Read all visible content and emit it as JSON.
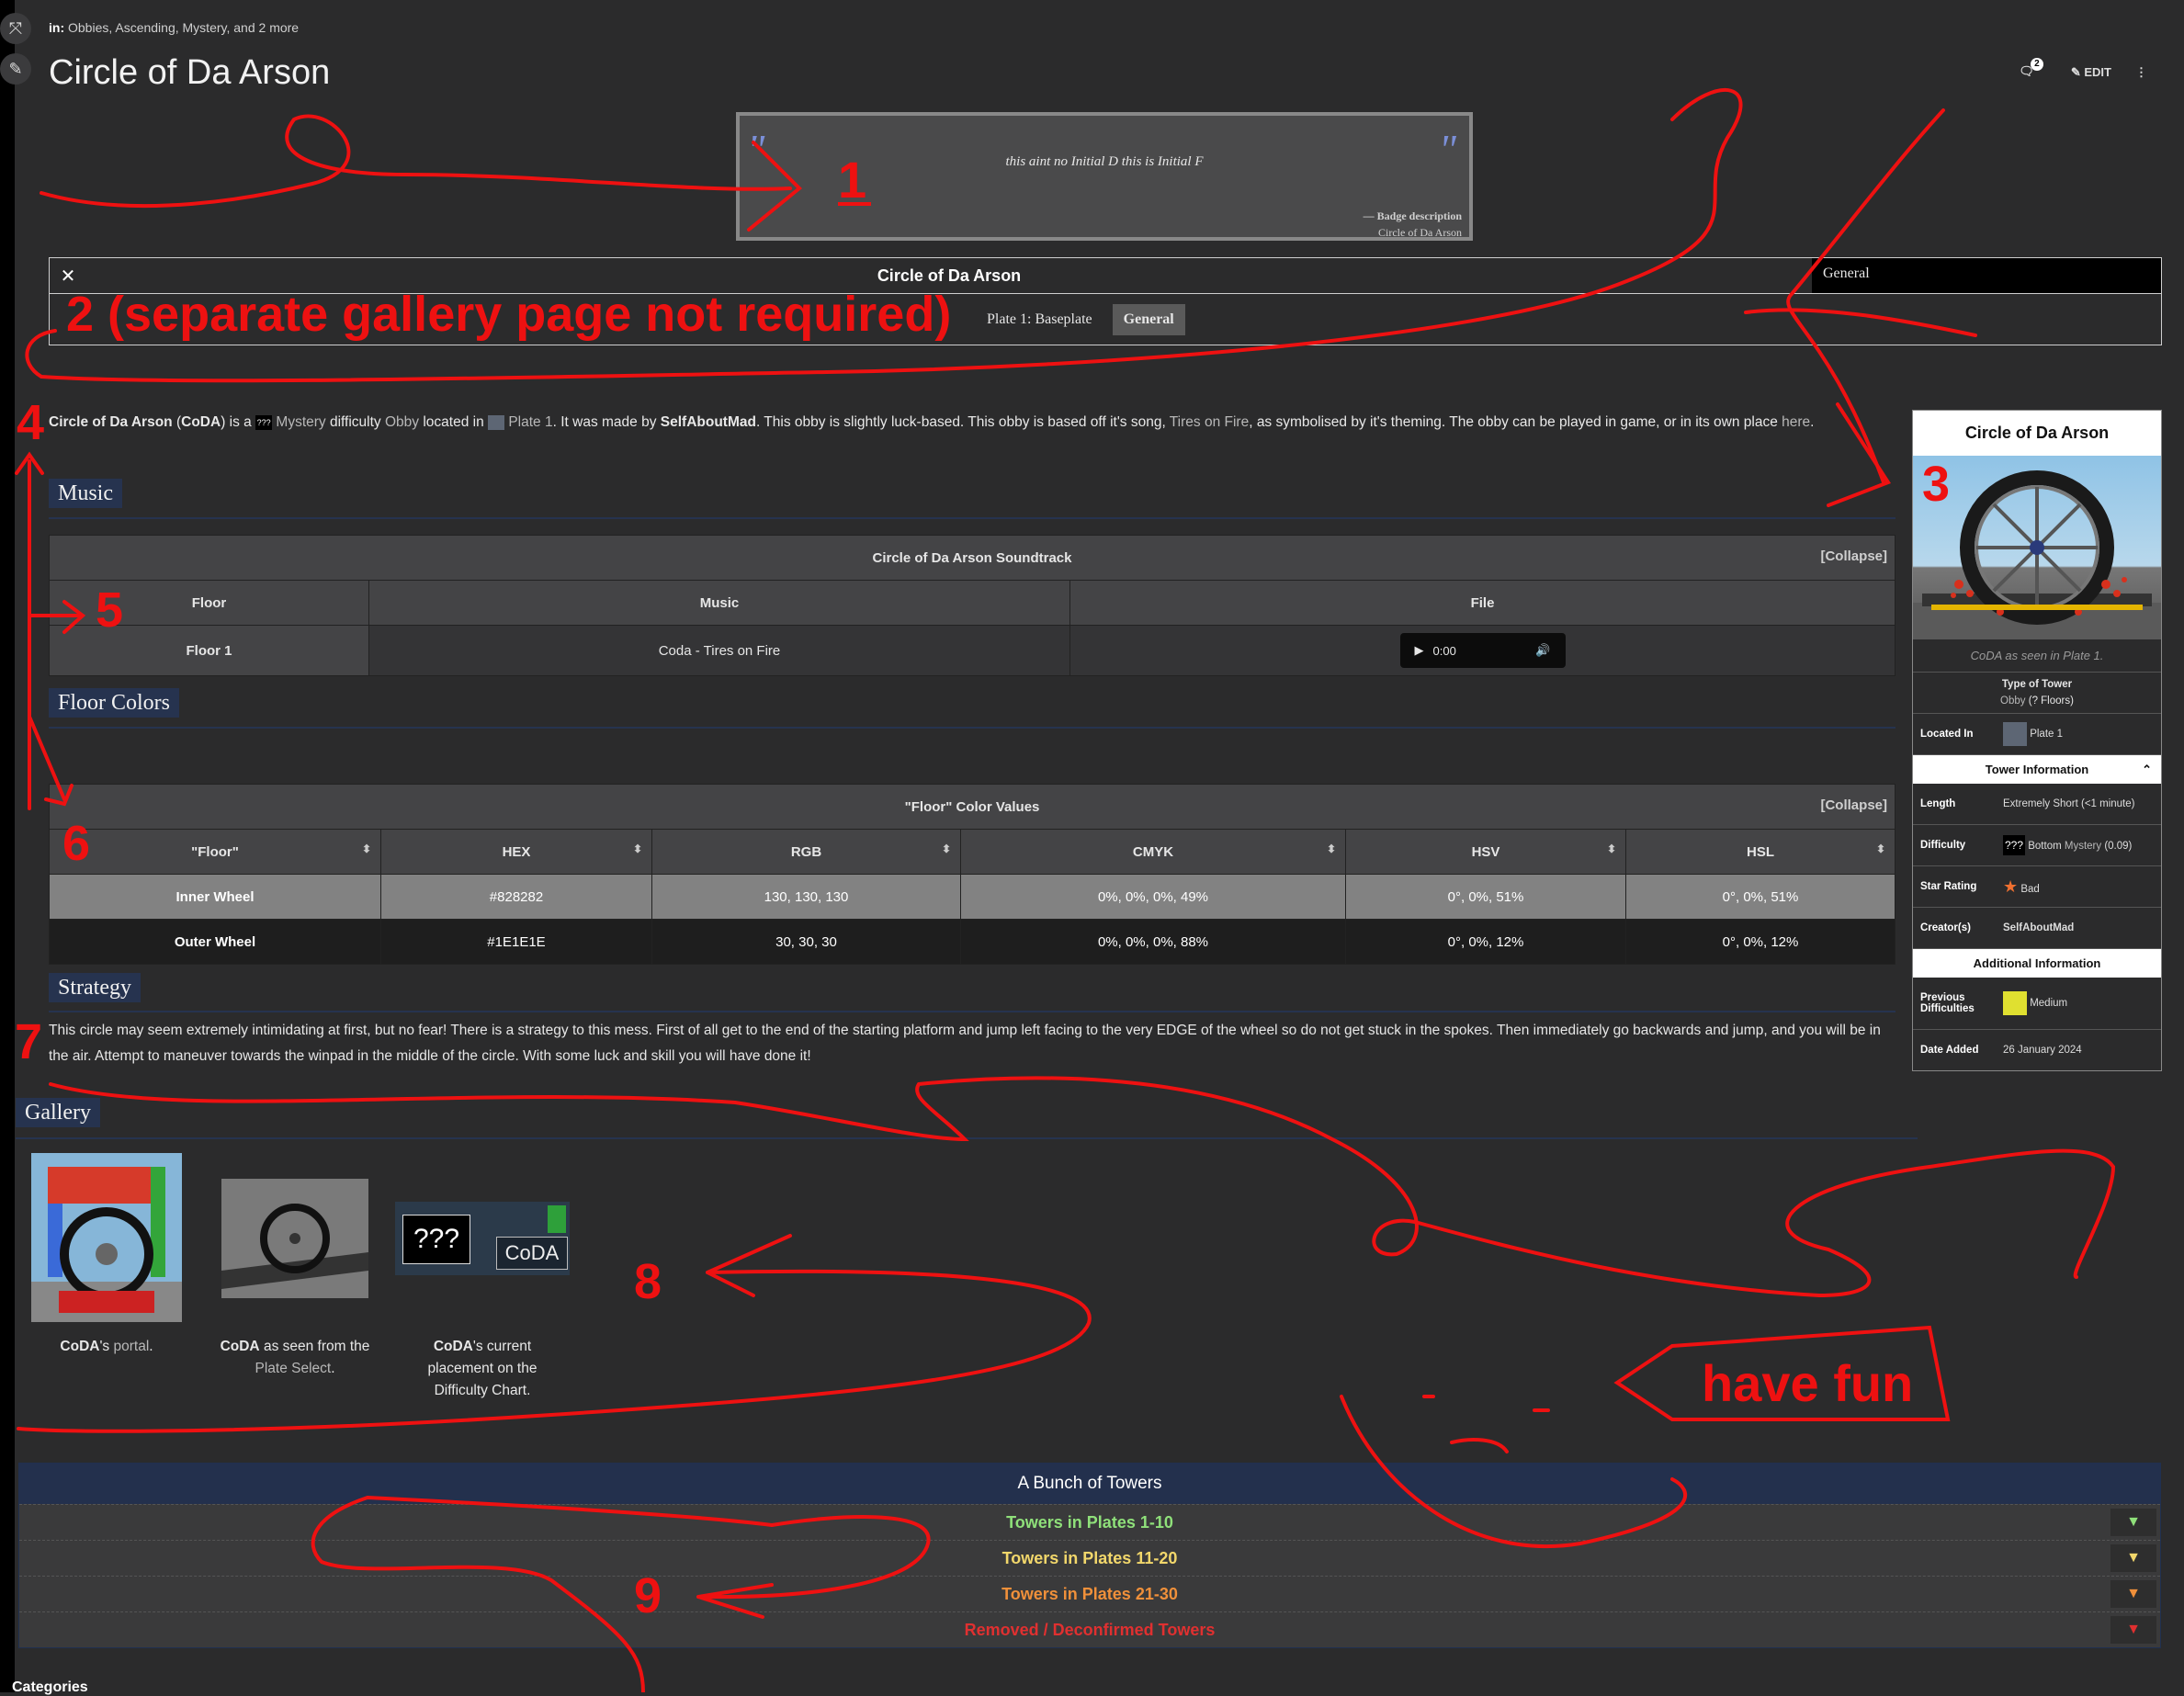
{
  "page": {
    "categories_prefix": "in:",
    "categories": "Obbies, Ascending, Mystery, and 2 more",
    "title": "Circle of Da Arson",
    "comment_count": "2",
    "edit_label": "EDIT"
  },
  "quote": {
    "text": "this aint no Initial D this is Initial F",
    "cite_label": "— Badge description",
    "cite_source": "Circle of Da Arson"
  },
  "tabber": {
    "title": "Circle of Da Arson",
    "right_tab": "General",
    "tab_plate": "Plate 1: Baseplate",
    "tab_general": "General"
  },
  "intro": {
    "name_bold": "Circle of Da Arson",
    "abbr": "CoDA",
    "t1": " is a ",
    "icon_text": "???",
    "difficulty": "Mystery",
    "t2": " difficulty ",
    "obby": "Obby",
    "t3": " located in ",
    "plate": "Plate 1",
    "t4": ". It was made by ",
    "creator": "SelfAboutMad",
    "t5": ". This obby is slightly luck-based. This obby is based off it's song, ",
    "song": "Tires on Fire",
    "t6": ", as symbolised by it's theming. The obby can be played in game, or in its own place ",
    "here": "here",
    "t7": "."
  },
  "music": {
    "heading": "Music",
    "table_title": "Circle of Da Arson Soundtrack",
    "collapse": "[Collapse]",
    "headers": [
      "Floor",
      "Music",
      "File"
    ],
    "row": {
      "floor": "Floor 1",
      "music": "Coda - Tires on Fire",
      "time": "0:00"
    }
  },
  "colors": {
    "heading": "Floor Colors",
    "table_title": "\"Floor\" Color Values",
    "collapse": "[Collapse]",
    "headers": [
      "\"Floor\"",
      "HEX",
      "RGB",
      "CMYK",
      "HSV",
      "HSL"
    ],
    "rows": [
      {
        "name": "Inner Wheel",
        "hex": "#828282",
        "rgb": "130, 130, 130",
        "cmyk": "0%, 0%, 0%, 49%",
        "hsv": "0°, 0%, 51%",
        "hsl": "0°, 0%, 51%"
      },
      {
        "name": "Outer Wheel",
        "hex": "#1E1E1E",
        "rgb": "30, 30, 30",
        "cmyk": "0%, 0%, 0%, 88%",
        "hsv": "0°, 0%, 12%",
        "hsl": "0°, 0%, 12%"
      }
    ]
  },
  "strategy": {
    "heading": "Strategy",
    "text": "This circle may seem extremely intimidating at first, but no fear! There is a strategy to this mess. First of all get to the end of the starting platform and jump left facing to the very EDGE of the wheel so do not get stuck in the spokes. Then immediately go backwards and jump, and you will be in the air. Attempt to maneuver towards the winpad in the middle of the circle. With some luck and skill you will have done it!"
  },
  "infobox": {
    "title": "Circle of Da Arson",
    "caption": "CoDA as seen in Plate 1.",
    "type_label": "Type of Tower",
    "type_value_link": "Obby",
    "type_value_rest": " (? Floors)",
    "located_label": "Located In",
    "located_value": "Plate 1",
    "tower_info": "Tower Information",
    "length_label": "Length",
    "length_value": "Extremely Short (<1 minute)",
    "difficulty_label": "Difficulty",
    "difficulty_icon": "???",
    "difficulty_value": "Bottom",
    "difficulty_link": "Mystery",
    "difficulty_num": "(0.09)",
    "star_label": "Star Rating",
    "star_value": "Bad",
    "creator_label": "Creator(s)",
    "creator_value": "SelfAboutMad",
    "additional": "Additional Information",
    "prev_label": "Previous Difficulties",
    "prev_value": "Medium",
    "date_label": "Date Added",
    "date_value": "26 January 2024"
  },
  "gallery": {
    "heading": "Gallery",
    "items": [
      {
        "bold": "CoDA",
        "rest": "'s ",
        "link": "portal",
        "end": "."
      },
      {
        "bold": "CoDA",
        "rest": " as seen from the",
        "link": "Plate Select",
        "end": "."
      },
      {
        "bold": "CoDA",
        "rest": "'s current",
        "line2": "placement on the",
        "line3": "Difficulty Chart."
      }
    ],
    "thumb3_left": "???",
    "thumb3_right": "CoDA"
  },
  "navbox": {
    "title": "A Bunch of Towers",
    "rows": [
      {
        "label": "Towers in Plates 1-10",
        "color": "#8fe07a"
      },
      {
        "label": "Towers in Plates 11-20",
        "color": "#f2d76b"
      },
      {
        "label": "Towers in Plates 21-30",
        "color": "#f0903a"
      },
      {
        "label": "Removed / Deconfirmed Towers",
        "color": "#e03030"
      }
    ]
  },
  "footer": {
    "categories": "Categories"
  },
  "annotations": {
    "n1": "1",
    "n2": "2 (separate gallery page not required)",
    "n3": "3",
    "n4": "4",
    "n5": "5",
    "n6": "6",
    "n7": "7",
    "n8": "8",
    "n9": "9",
    "have_fun": "have fun"
  }
}
